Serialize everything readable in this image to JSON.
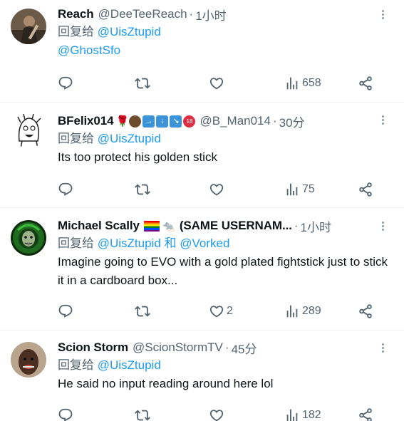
{
  "tweets": [
    {
      "name": "Reach",
      "handle": "@DeeTeeReach",
      "separator": "·",
      "time": "1小时",
      "reply_prefix": "回复给",
      "reply_to": "@UisZtupid",
      "reply_and": "",
      "reply_to_2": "",
      "text": "",
      "mention": "@GhostSfo",
      "replies": "",
      "retweets": "",
      "likes": "",
      "views": "658"
    },
    {
      "name": "BFelix014",
      "handle": "@B_Man014",
      "separator": "·",
      "time": "30分",
      "reply_prefix": "回复给",
      "reply_to": "@UisZtupid",
      "text": "Its too protect his golden stick",
      "replies": "",
      "retweets": "",
      "likes": "",
      "views": "75"
    },
    {
      "name": "Michael Scally",
      "name_suffix": "(SAME USERNAM...",
      "separator": "·",
      "time": "1小时",
      "reply_prefix": "回复给",
      "reply_to": "@UisZtupid",
      "reply_and": "和",
      "reply_to_2": "@Vorked",
      "text": "Imagine going to EVO with a gold plated fightstick just to stick it in a cardboard box...",
      "replies": "",
      "retweets": "",
      "likes": "2",
      "views": "289"
    },
    {
      "name": "Scion Storm",
      "handle": "@ScionStormTV",
      "separator": "·",
      "time": "45分",
      "reply_prefix": "回复给",
      "reply_to": "@UisZtupid",
      "text": "He said no input reading around here lol",
      "replies": "",
      "retweets": "",
      "likes": "",
      "views": "182"
    }
  ],
  "icons": {
    "reply": "reply-icon",
    "retweet": "retweet-icon",
    "like": "heart-icon",
    "views": "views-icon",
    "share": "share-icon",
    "more": "more-icon"
  },
  "colors": {
    "link": "#1d9bf0",
    "secondary": "#536471",
    "primary": "#0f1419",
    "divider": "#eff3f4"
  }
}
